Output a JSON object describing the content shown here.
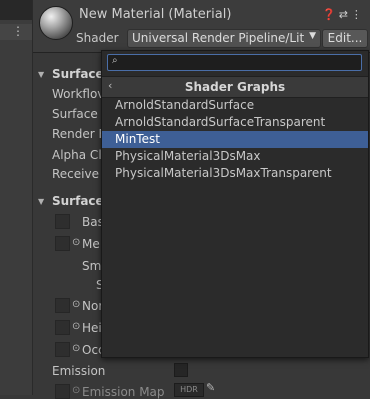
{
  "window": {
    "title": "New Material (Material)"
  },
  "shader": {
    "label": "Shader",
    "value": "Universal Render Pipeline/Lit",
    "edit_label": "Edit..."
  },
  "left_strip": {
    "dots": "⋮"
  },
  "properties": {
    "surface_options_header": "Surface",
    "workflow_label": "Workflov",
    "surface_label": "Surface",
    "render_face_label": "Render F",
    "alpha_clip_label": "Alpha Cl",
    "receive_label": "Receive",
    "surface_inputs_header": "Surface",
    "base_label": "Bas",
    "metallic_label": "Me",
    "smoothness_label": "Sm",
    "source_label": "S",
    "normal_label": "Nor",
    "height_label": "Hei",
    "occlusion_label": "Occ",
    "emission_label": "Emission",
    "emission_map_label": "Emission Map",
    "hdr_badge": "HDR"
  },
  "popup": {
    "search": {
      "value": "",
      "placeholder": ""
    },
    "header": "Shader Graphs",
    "items": [
      {
        "label": "ArnoldStandardSurface",
        "selected": false
      },
      {
        "label": "ArnoldStandardSurfaceTransparent",
        "selected": false
      },
      {
        "label": "MinTest",
        "selected": true
      },
      {
        "label": "PhysicalMaterial3DsMax",
        "selected": false
      },
      {
        "label": "PhysicalMaterial3DsMaxTransparent",
        "selected": false
      }
    ]
  },
  "colors": {
    "selection": "#3e5f96",
    "background": "#383838",
    "popup": "#2b2b2b"
  }
}
